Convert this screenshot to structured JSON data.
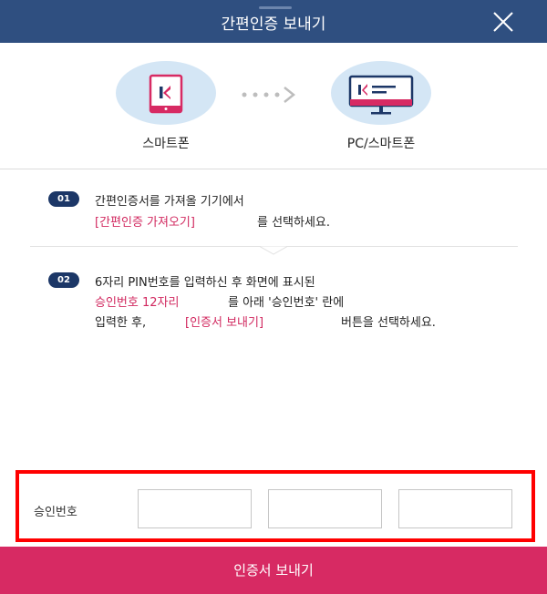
{
  "header": {
    "title": "간편인증 보내기"
  },
  "devices": {
    "from_label": "스마트폰",
    "to_label": "PC/스마트폰"
  },
  "steps": [
    {
      "badge": "01",
      "line1": "간편인증서를 가져올 기기에서",
      "highlight": "[간편인증 가져오기]",
      "after": "를 선택하세요."
    },
    {
      "badge": "02",
      "line1": "6자리 PIN번호를 입력하신 후 화면에 표시된",
      "highlight1": "승인번호 12자리",
      "after1": "를 아래 '승인번호' 란에",
      "line3_before": "입력한 후,",
      "highlight2": "[인증서 보내기]",
      "after2": "버튼을 선택하세요."
    }
  ],
  "code": {
    "label": "승인번호",
    "fields": [
      "",
      "",
      ""
    ]
  },
  "submit": {
    "label": "인증서 보내기"
  },
  "icons": {
    "close": "close-icon",
    "phone": "smartphone-icon",
    "monitor": "monitor-icon",
    "arrow": "arrow-right-icon"
  },
  "colors": {
    "header": "#2f4f80",
    "accent": "#d72a63",
    "highlight": "#d1285f",
    "badge": "#1c3767",
    "device_bg": "#d4e6f5"
  }
}
